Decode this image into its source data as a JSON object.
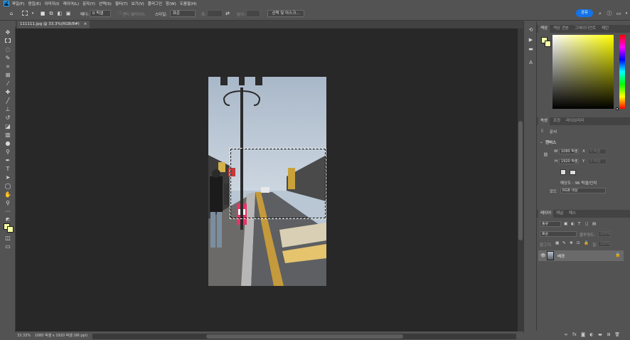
{
  "menu": {
    "app_badge": "Ps",
    "items": [
      "파일(F)",
      "편집(E)",
      "이미지(I)",
      "레이어(L)",
      "문자(Y)",
      "선택(S)",
      "필터(T)",
      "보기(V)",
      "플러그인",
      "창(W)",
      "도움말(H)"
    ]
  },
  "options": {
    "feather_label": "페더:",
    "feather_value": "0 픽셀",
    "antialias_label": "앤티 앨리어스",
    "style_label": "스타일:",
    "style_value": "표준",
    "width_label": "폭:",
    "height_label": "높이:",
    "select_mask_button": "선택 및 마스크...",
    "share_button": "공유"
  },
  "document": {
    "tab_title": "111111.jpg @ 33.3%(RGB/8#)",
    "close_glyph": "×"
  },
  "status": {
    "zoom": "33.33%",
    "info": "1080 픽셀 x 1920 픽셀 (96 ppi)"
  },
  "color_panel": {
    "tabs": [
      "색상",
      "색상 견본",
      "그레이디언트",
      "패턴"
    ],
    "foreground_color": "#f7ffa8",
    "picker_hue": "#ffff00"
  },
  "properties_panel": {
    "tabs": [
      "속성",
      "조정",
      "라이브러리"
    ],
    "doc_label": "문서",
    "section_label": "캔버스",
    "w_label": "W",
    "w_value": "1080 픽셀",
    "h_label": "H",
    "h_value": "1920 픽셀",
    "x_label": "X",
    "x_value": "0 픽셀",
    "y_label": "Y",
    "y_value": "0 픽셀",
    "resolution": "해상도 : 96 픽셀/인치",
    "mode_label": "모드",
    "mode_value": "RGB 색상"
  },
  "layers_panel": {
    "tabs": [
      "레이어",
      "채널",
      "패스"
    ],
    "search_placeholder": "종류",
    "blend_mode": "표준",
    "opacity_label": "불투명도:",
    "opacity_value": "100%",
    "lock_label": "잠그기:",
    "fill_label": "칠:",
    "fill_value": "100%",
    "layer_name": "배경"
  }
}
